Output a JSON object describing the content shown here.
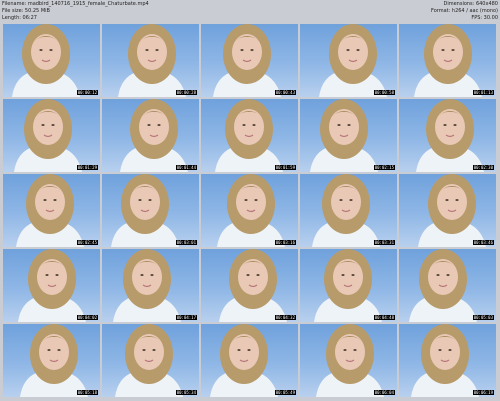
{
  "header": {
    "filename": "Filename: madbird_140716_1915_female_Chaturbate.mp4",
    "filesize": "File size: 50.25 MiB",
    "length": "Length: 06:27",
    "dimensions": "Dimensions: 640x480",
    "format": "Format: h264 / aac (mono)",
    "fps": "FPS: 30.00"
  },
  "thumbnails": [
    {
      "time": "00:00:12"
    },
    {
      "time": "00:00:28"
    },
    {
      "time": "00:00:43"
    },
    {
      "time": "00:00:58"
    },
    {
      "time": "00:01:13"
    },
    {
      "time": "00:01:29"
    },
    {
      "time": "00:01:44"
    },
    {
      "time": "00:01:59"
    },
    {
      "time": "00:02:15"
    },
    {
      "time": "00:02:30"
    },
    {
      "time": "00:02:45"
    },
    {
      "time": "00:03:01"
    },
    {
      "time": "00:03:16"
    },
    {
      "time": "00:03:31"
    },
    {
      "time": "00:03:46"
    },
    {
      "time": "00:04:02"
    },
    {
      "time": "00:04:17"
    },
    {
      "time": "00:04:32"
    },
    {
      "time": "00:04:48"
    },
    {
      "time": "00:05:03"
    },
    {
      "time": "00:05:18"
    },
    {
      "time": "00:05:34"
    },
    {
      "time": "00:05:49"
    },
    {
      "time": "00:06:04"
    },
    {
      "time": "00:06:19"
    }
  ]
}
